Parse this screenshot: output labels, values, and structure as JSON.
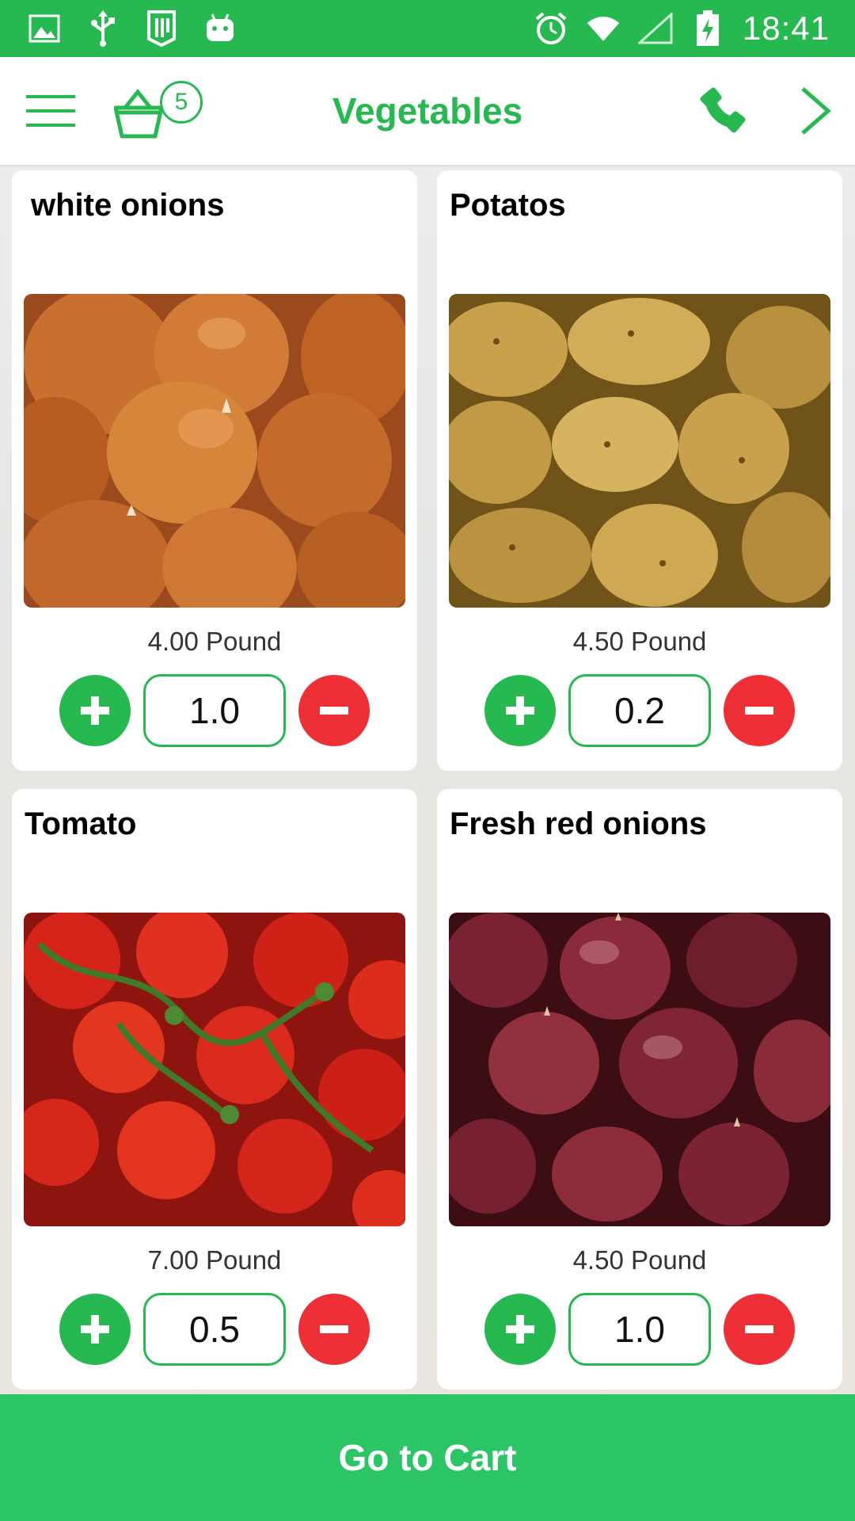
{
  "status_bar": {
    "time": "18:41",
    "left_icons": [
      "image-icon",
      "usb-icon",
      "sim-card-icon",
      "android-icon"
    ],
    "right_icons": [
      "alarm-icon",
      "wifi-icon",
      "signal-icon",
      "battery-charging-icon"
    ]
  },
  "toolbar": {
    "title": "Vegetables",
    "cart_count": "5"
  },
  "products": [
    {
      "name": "white onions",
      "price": "4.00 Pound",
      "quantity": "1.0",
      "image": "onions-photo"
    },
    {
      "name": "Potatos",
      "price": "4.50 Pound",
      "quantity": "0.2",
      "image": "potatoes-photo"
    },
    {
      "name": "Tomato",
      "price": "7.00 Pound",
      "quantity": "0.5",
      "image": "tomatoes-photo"
    },
    {
      "name": "Fresh red onions",
      "price": "4.50 Pound",
      "quantity": "1.0",
      "image": "red-onions-photo"
    }
  ],
  "footer": {
    "go_to_cart_label": "Go to Cart"
  },
  "colors": {
    "primary_green": "#26b950",
    "button_green": "#2cc566",
    "minus_red": "#ef2f36",
    "card_background": "#ffffff"
  }
}
